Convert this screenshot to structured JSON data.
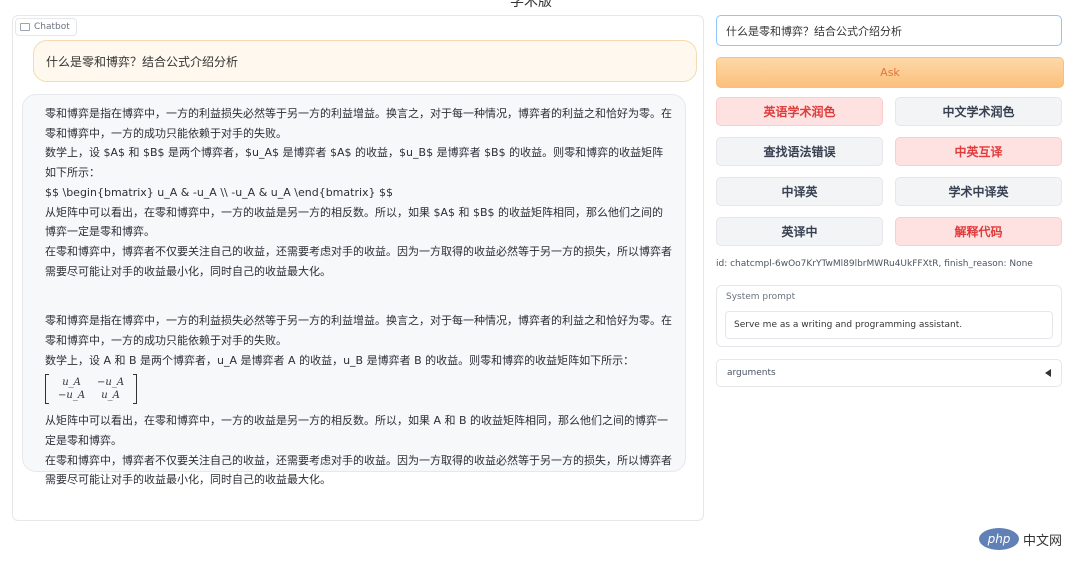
{
  "top_fragment": "学术版",
  "chat": {
    "label": "Chatbot",
    "user_message": "什么是零和博弈？结合公式介绍分析",
    "bot_raw_lines": [
      "零和博弈是指在博弈中，一方的利益损失必然等于另一方的利益增益。换言之，对于每一种情况，博弈者的利益之和恰好为零。在零和博弈中，一方的成功只能依赖于对手的失败。",
      "数学上，设 $A$ 和 $B$ 是两个博弈者，$u_A$ 是博弈者 $A$ 的收益，$u_B$ 是博弈者 $B$ 的收益。则零和博弈的收益矩阵如下所示：",
      "$$ \\begin{bmatrix} u_A & -u_A \\\\ -u_A & u_A \\end{bmatrix} $$",
      "从矩阵中可以看出，在零和博弈中，一方的收益是另一方的相反数。所以，如果 $A$ 和 $B$ 的收益矩阵相同，那么他们之间的博弈一定是零和博弈。",
      "在零和博弈中，博弈者不仅要关注自己的收益，还需要考虑对手的收益。因为一方取得的收益必然等于另一方的损失，所以博弈者需要尽可能让对手的收益最小化，同时自己的收益最大化。"
    ],
    "bot_rendered": {
      "p1": "零和博弈是指在博弈中，一方的利益损失必然等于另一方的利益增益。换言之，对于每一种情况，博弈者的利益之和恰好为零。在零和博弈中，一方的成功只能依赖于对手的失败。",
      "p2": "数学上，设 A 和 B 是两个博弈者，u_A 是博弈者 A 的收益，u_B 是博弈者 B 的收益。则零和博弈的收益矩阵如下所示：",
      "matrix": [
        [
          "u_A",
          "−u_A"
        ],
        [
          "−u_A",
          "u_A"
        ]
      ],
      "p3": "从矩阵中可以看出，在零和博弈中，一方的收益是另一方的相反数。所以，如果 A 和 B 的收益矩阵相同，那么他们之间的博弈一定是零和博弈。",
      "p4": "在零和博弈中，博弈者不仅要关注自己的收益，还需要考虑对手的收益。因为一方取得的收益必然等于另一方的损失，所以博弈者需要尽可能让对手的收益最小化，同时自己的收益最大化。"
    }
  },
  "input": {
    "value": "什么是零和博弈？结合公式介绍分析"
  },
  "ask_label": "Ask",
  "buttons": [
    {
      "label": "英语学术润色",
      "color": "red"
    },
    {
      "label": "中文学术润色",
      "color": "gray"
    },
    {
      "label": "查找语法错误",
      "color": "gray"
    },
    {
      "label": "中英互译",
      "color": "red"
    },
    {
      "label": "中译英",
      "color": "gray"
    },
    {
      "label": "学术中译英",
      "color": "gray"
    },
    {
      "label": "英译中",
      "color": "gray"
    },
    {
      "label": "解释代码",
      "color": "red"
    }
  ],
  "status_id": "id: chatcmpl-6wOo7KrYTwMl89lbrMWRu4UkFFXtR, finish_reason: None",
  "system_prompt": {
    "label": "System prompt",
    "value": "Serve me as a writing and programming assistant."
  },
  "arguments_label": "arguments",
  "watermark": {
    "logo": "php",
    "text": "中文网"
  },
  "colors": {
    "accent_red": "#e03c3c",
    "ask_orange": "#fbc07c",
    "input_border": "#93c5fd"
  }
}
